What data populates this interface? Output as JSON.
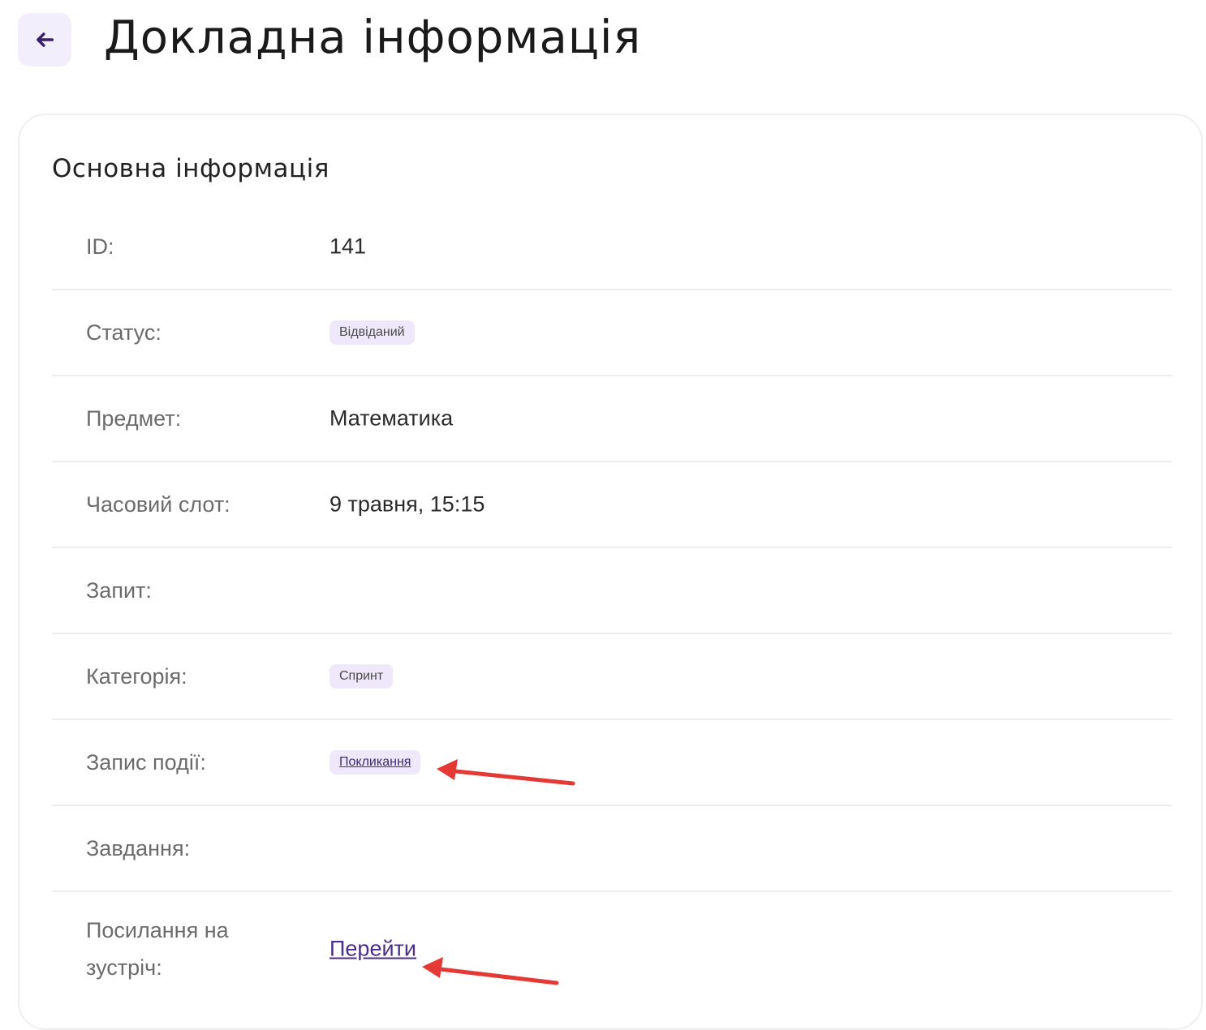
{
  "header": {
    "back_icon": "arrow-left-icon",
    "title": "Докладна інформація"
  },
  "card": {
    "title": "Основна інформація",
    "rows": [
      {
        "label": "ID:",
        "value": "141"
      },
      {
        "label": "Статус:",
        "value": "Відвіданий"
      },
      {
        "label": "Предмет:",
        "value": "Математика"
      },
      {
        "label": "Часовий слот:",
        "value": "9 травня, 15:15"
      },
      {
        "label": "Запит:",
        "value": ""
      },
      {
        "label": "Категорія:",
        "value": "Спринт"
      },
      {
        "label": "Запис події:",
        "value": "Покликання"
      },
      {
        "label": "Завдання:",
        "value": ""
      },
      {
        "label": "Посилання на зустріч:",
        "value": "Перейти"
      }
    ]
  },
  "colors": {
    "accent": "#4a2f8a",
    "badge_bg": "#efe8fa",
    "back_button_bg": "#f3eefb",
    "annotation_arrow": "#e53935"
  }
}
